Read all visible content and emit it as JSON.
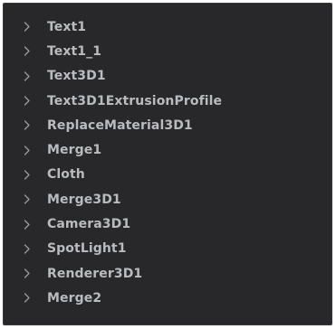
{
  "tree": {
    "items": [
      {
        "label": "Text1",
        "icon": "chevron-right-icon"
      },
      {
        "label": "Text1_1",
        "icon": "chevron-right-icon"
      },
      {
        "label": "Text3D1",
        "icon": "chevron-right-icon"
      },
      {
        "label": "Text3D1ExtrusionProfile",
        "icon": "chevron-right-icon"
      },
      {
        "label": "ReplaceMaterial3D1",
        "icon": "chevron-right-icon"
      },
      {
        "label": "Merge1",
        "icon": "chevron-right-icon"
      },
      {
        "label": "Cloth",
        "icon": "chevron-right-icon"
      },
      {
        "label": "Merge3D1",
        "icon": "chevron-right-icon"
      },
      {
        "label": "Camera3D1",
        "icon": "chevron-right-icon"
      },
      {
        "label": "SpotLight1",
        "icon": "chevron-right-icon"
      },
      {
        "label": "Renderer3D1",
        "icon": "chevron-right-icon"
      },
      {
        "label": "Merge2",
        "icon": "chevron-right-icon"
      }
    ]
  },
  "colors": {
    "panel_background": "#28282a",
    "text": "#b9bbbe",
    "chevron": "#9a9c9f"
  }
}
